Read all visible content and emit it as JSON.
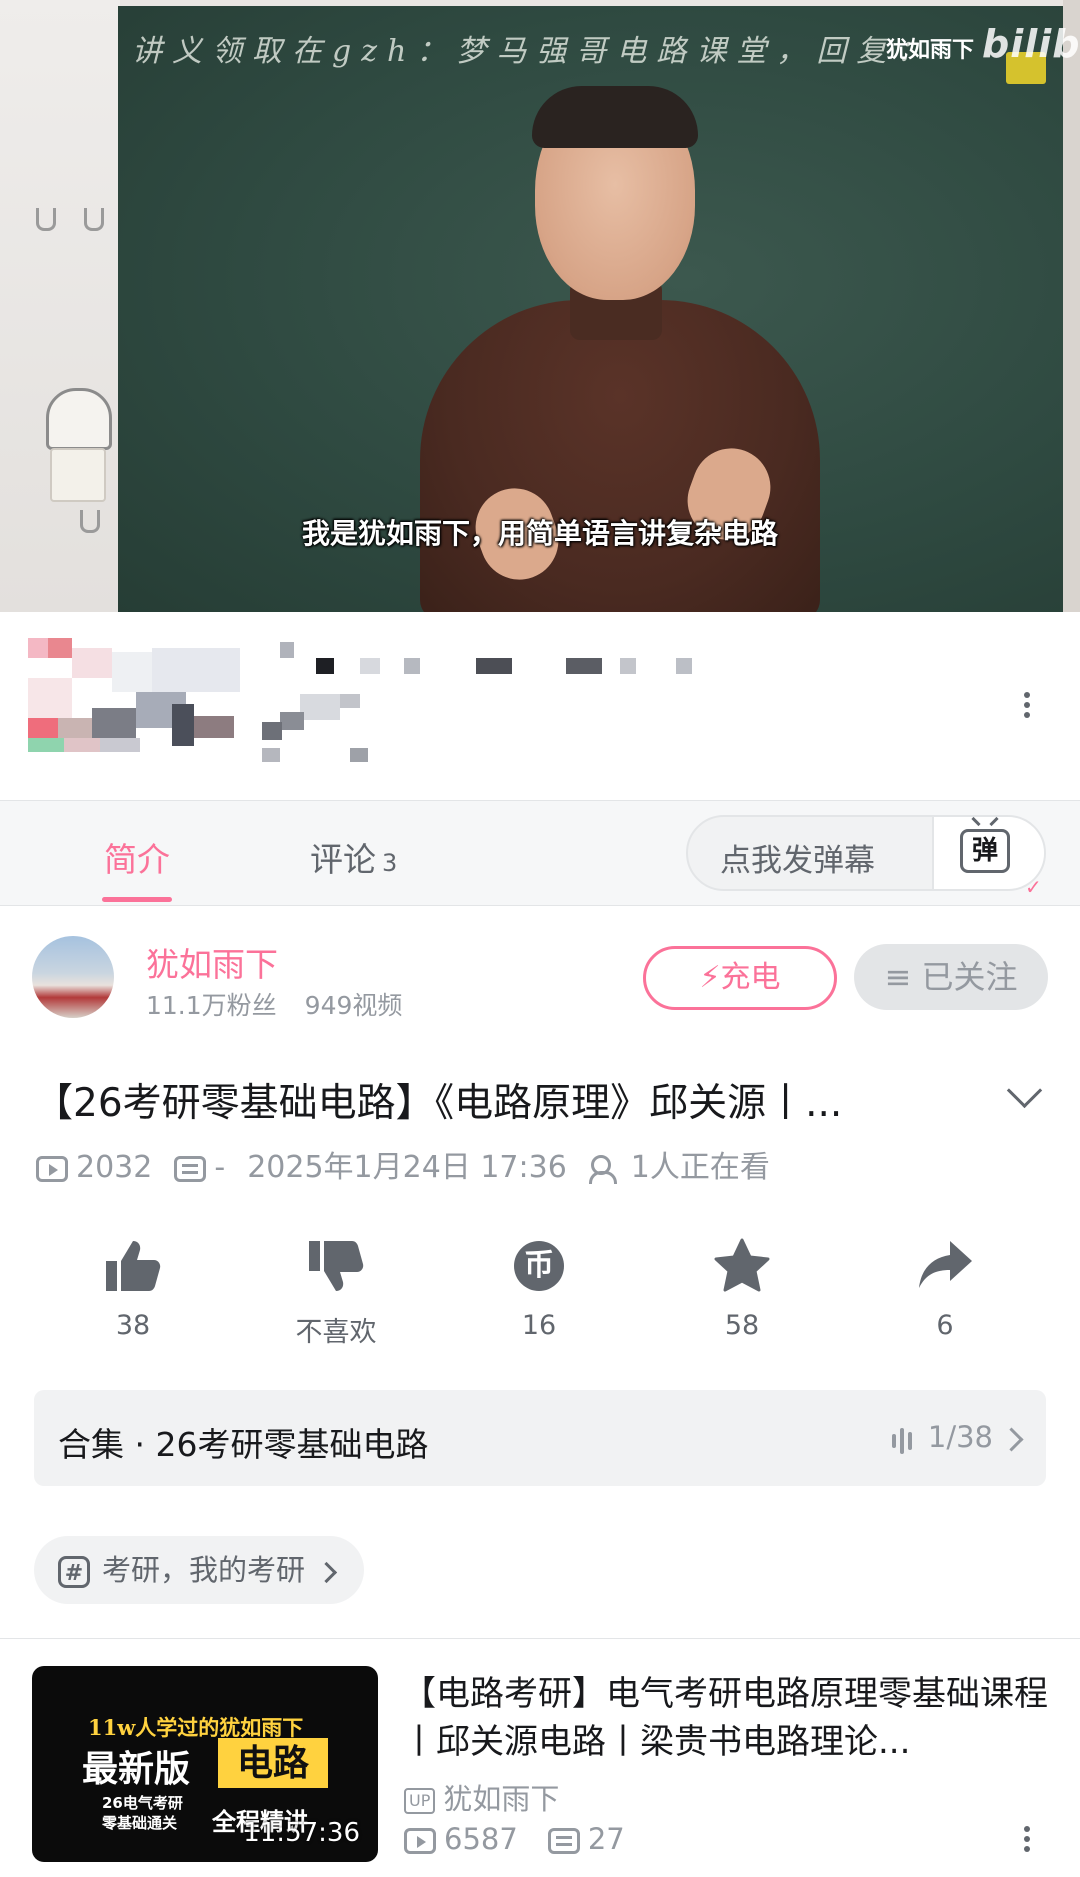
{
  "player": {
    "board_note": "讲义领取在gzh：梦马强哥电路课堂，回复：",
    "watermark_uploader": "犹如雨下",
    "watermark_brand": "bilibili",
    "subtitle": "我是犹如雨下，用简单语言讲复杂电路"
  },
  "tabs": {
    "intro": "简介",
    "comments": "评论",
    "comments_count": "3",
    "danmaku_placeholder": "点我发弹幕",
    "danmaku_icon_glyph": "弹"
  },
  "uploader": {
    "name": "犹如雨下",
    "fans": "11.1万粉丝",
    "videos": "949视频",
    "charge_label": "充电",
    "follow_label": "已关注"
  },
  "video": {
    "title": "【26考研零基础电路】《电路原理》邱关源丨...",
    "views": "2032",
    "danmaku_count": "-",
    "date": "2025年1月24日 17:36",
    "watching": "1人正在看"
  },
  "actions": [
    {
      "name": "like",
      "label": "38"
    },
    {
      "name": "dislike",
      "label": "不喜欢"
    },
    {
      "name": "coin",
      "label": "16",
      "glyph": "币"
    },
    {
      "name": "favorite",
      "label": "58"
    },
    {
      "name": "share",
      "label": "6"
    }
  ],
  "collection": {
    "label": "合集 · 26考研零基础电路",
    "progress": "1/38"
  },
  "tag": {
    "text": "考研，我的考研"
  },
  "related": {
    "thumb_line1": "11w人学过的犹如雨下",
    "thumb_line2": "最新版",
    "thumb_box": "电路",
    "thumb_line3": "26电气考研",
    "thumb_line4": "零基础通关",
    "thumb_line5": "全程精讲",
    "duration": "11:57:36",
    "title": "【电路考研】电气考研电路原理零基础课程丨邱关源电路丨梁贵书电路理论...",
    "up_badge": "UP",
    "uploader": "犹如雨下",
    "views": "6587",
    "danmaku": "27"
  },
  "colors": {
    "accent": "#fb7299",
    "text_primary": "#18191c",
    "text_secondary": "#61666d",
    "text_tertiary": "#9499a0"
  }
}
